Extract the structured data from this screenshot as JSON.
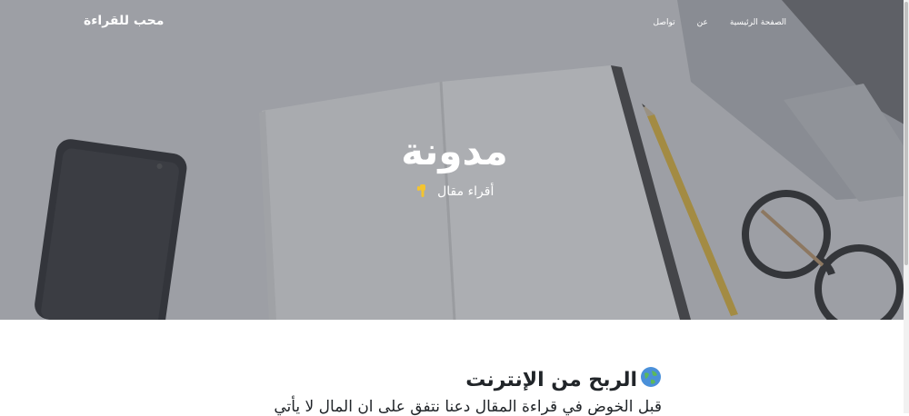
{
  "nav": {
    "brand": "محب للقراءة",
    "links": [
      "الصفحة الرئيسية",
      "عن",
      "تواصل"
    ]
  },
  "hero": {
    "title": "مدونة",
    "subtitle": "أقراء مقال",
    "hand_icon": "backhand-pointing-down-icon"
  },
  "post": {
    "title": "الربح من الإنترنت",
    "globe_icon": "globe-icon",
    "excerpt": "قبل الخوض في قراءة المقال دعنا نتفق على ان المال لا يأتي"
  },
  "colors": {
    "overlay": "#50545e",
    "text_dark": "#212529",
    "pencil": "#e8b92e"
  }
}
